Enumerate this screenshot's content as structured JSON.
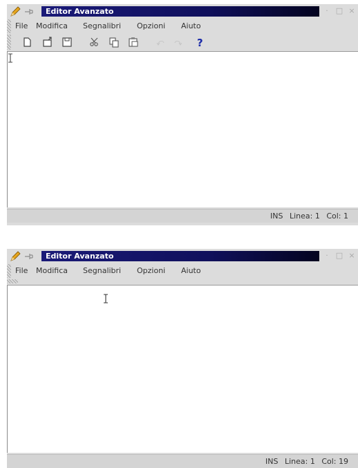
{
  "windows": [
    {
      "title": "Editor Avanzato",
      "menu": [
        "File",
        "Modifica",
        "Segnalibri",
        "Opzioni",
        "Aiuto"
      ],
      "toolbar_icons": [
        "new-file-icon",
        "open-file-icon",
        "save-icon",
        "cut-icon",
        "copy-icon",
        "paste-icon",
        "undo-icon",
        "redo-icon",
        "help-icon"
      ],
      "status": {
        "mode": "INS",
        "line": "Linea: 1",
        "col": "Col: 1"
      }
    },
    {
      "title": "Editor Avanzato",
      "menu": [
        "File",
        "Modifica",
        "Segnalibri",
        "Opzioni",
        "Aiuto"
      ],
      "status": {
        "mode": "INS",
        "line": "Linea: 1",
        "col": "Col: 19"
      }
    }
  ],
  "colors": {
    "title_bar": "#1a1a78",
    "window_bg": "#dcdcdc",
    "text_area": "#ffffff",
    "help_icon": "#1a2aa8"
  }
}
